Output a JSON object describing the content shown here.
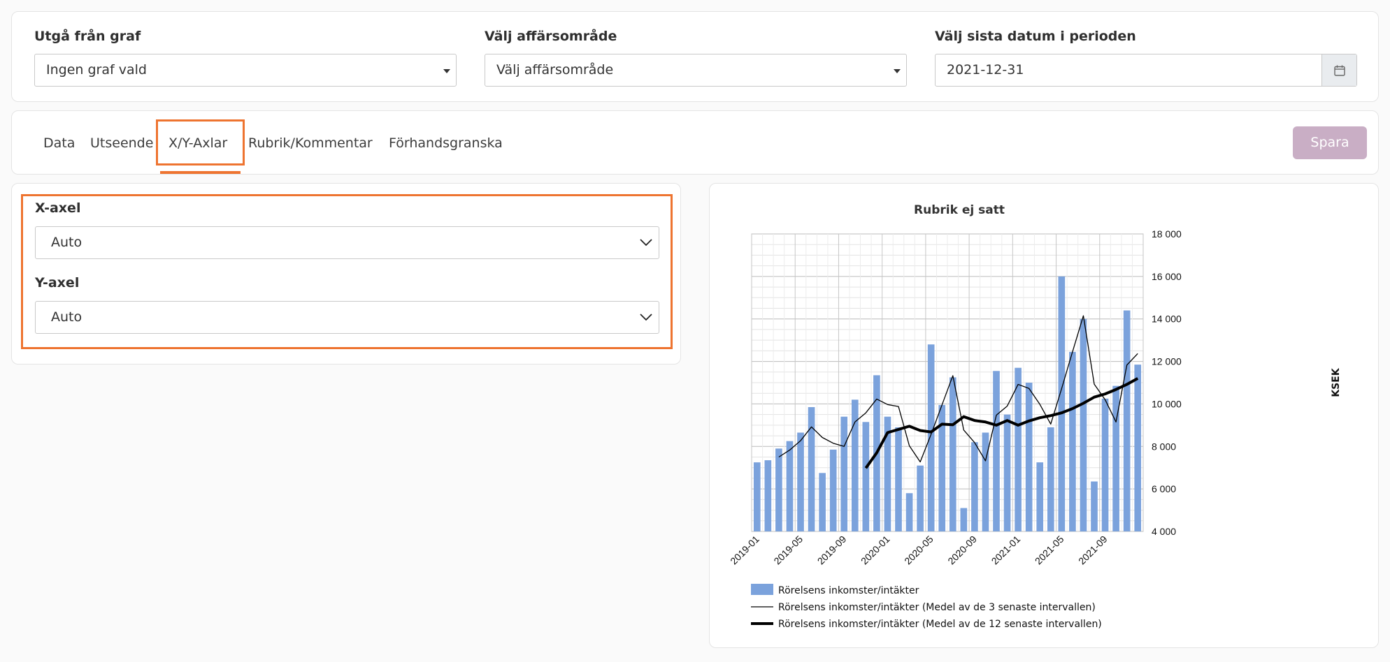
{
  "filters": {
    "graph": {
      "label": "Utgå från graf",
      "value": "Ingen graf vald"
    },
    "area": {
      "label": "Välj affärsområde",
      "value": "Välj affärsområde"
    },
    "date": {
      "label": "Välj sista datum i perioden",
      "value": "2021-12-31"
    }
  },
  "tabs": [
    {
      "label": "Data"
    },
    {
      "label": "Utseende"
    },
    {
      "label": "X/Y-Axlar",
      "active": true
    },
    {
      "label": "Rubrik/Kommentar"
    },
    {
      "label": "Förhandsgranska"
    }
  ],
  "save_label": "Spara",
  "axes": {
    "x": {
      "label": "X-axel",
      "value": "Auto"
    },
    "y": {
      "label": "Y-axel",
      "value": "Auto"
    }
  },
  "colors": {
    "accent": "#ee7430",
    "bar": "#7ba2dc",
    "save_disabled": "#c9aec5"
  },
  "chart_data": {
    "type": "bar",
    "title": "Rubrik ej satt",
    "ylabel": "KSEK",
    "ylim": [
      4000,
      18000
    ],
    "yticks": [
      4000,
      6000,
      8000,
      10000,
      12000,
      14000,
      16000,
      18000
    ],
    "ytick_labels": [
      "4 000",
      "6 000",
      "8 000",
      "10 000",
      "12 000",
      "14 000",
      "16 000",
      "18 000"
    ],
    "y_axis_side": "right",
    "grid": true,
    "legend_position": "bottom",
    "x_tick_labels": [
      "2019-01",
      "2019-05",
      "2019-09",
      "2020-01",
      "2020-05",
      "2020-09",
      "2021-01",
      "2021-05",
      "2021-09"
    ],
    "categories": [
      "2019-01",
      "2019-02",
      "2019-03",
      "2019-04",
      "2019-05",
      "2019-06",
      "2019-07",
      "2019-08",
      "2019-09",
      "2019-10",
      "2019-11",
      "2019-12",
      "2020-01",
      "2020-02",
      "2020-03",
      "2020-04",
      "2020-05",
      "2020-06",
      "2020-07",
      "2020-08",
      "2020-09",
      "2020-10",
      "2020-11",
      "2020-12",
      "2021-01",
      "2021-02",
      "2021-03",
      "2021-04",
      "2021-05",
      "2021-06",
      "2021-07",
      "2021-08",
      "2021-09",
      "2021-10",
      "2021-11",
      "2021-12"
    ],
    "series": [
      {
        "name": "Rörelsens inkomster/intäkter",
        "type": "bar",
        "values": [
          7250,
          7350,
          7900,
          8250,
          8650,
          9850,
          6750,
          7850,
          9400,
          10200,
          9150,
          11350,
          9400,
          8900,
          5800,
          7100,
          12800,
          9950,
          11250,
          5100,
          8200,
          8650,
          11550,
          9500,
          11700,
          11000,
          7250,
          8900,
          16000,
          12450,
          14000,
          6350,
          10250,
          10850,
          14400,
          11850
        ]
      },
      {
        "name": "Rörelsens inkomster/intäkter (Medel av de 3 senaste intervallen)",
        "type": "line",
        "values": [
          null,
          null,
          7500,
          7830,
          8270,
          8920,
          8420,
          8150,
          8000,
          9150,
          9580,
          10230,
          9970,
          9880,
          8030,
          7270,
          8570,
          9950,
          11330,
          8770,
          8180,
          7320,
          9470,
          9900,
          10920,
          10730,
          9980,
          9050,
          10720,
          12450,
          14150,
          10930,
          10200,
          9150,
          11830,
          12370
        ]
      },
      {
        "name": "Rörelsens inkomster/intäkter (Medel av de 12 senaste intervallen)",
        "type": "line",
        "values": [
          null,
          null,
          null,
          null,
          null,
          null,
          null,
          null,
          null,
          null,
          6980,
          7700,
          8650,
          8800,
          8950,
          8750,
          8680,
          9050,
          9020,
          9400,
          9220,
          9150,
          9000,
          9220,
          9000,
          9200,
          9350,
          9450,
          9580,
          9780,
          10030,
          10320,
          10470,
          10680,
          10920,
          11200
        ]
      }
    ]
  }
}
